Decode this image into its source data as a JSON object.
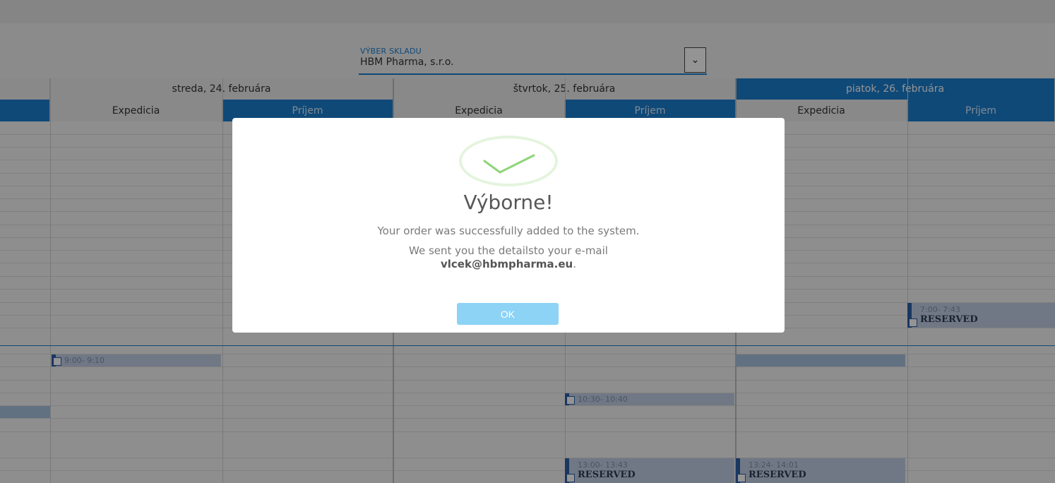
{
  "warehouse": {
    "label": "VÝBER SKLADU",
    "value": "HBM Pharma, s.r.o.",
    "dropdown_icon": "chevron-down-icon"
  },
  "days": [
    {
      "label": "streda, 24. februára",
      "active": false
    },
    {
      "label": "štvrtok, 25. februára",
      "active": false
    },
    {
      "label": "piatok, 26. februára",
      "active": true
    }
  ],
  "columns": {
    "expedicia": "Expedicia",
    "prijem": "Príjem"
  },
  "bookings": [
    {
      "time": "9:00- 9:10",
      "status": ""
    },
    {
      "time": "10:30- 10:40",
      "status": ""
    },
    {
      "time": "7:00- 7:43",
      "status": "RESERVED"
    },
    {
      "time": "13:00- 13:43",
      "status": "RESERVED"
    },
    {
      "time": "13:24- 14:01",
      "status": "RESERVED"
    }
  ],
  "modal": {
    "icon": "check-icon",
    "title": "Výborne!",
    "message": "Your order was successfully added to the system.",
    "details_prefix": "We sent you the detailsto your e-mail",
    "email": "vlcek@hbmpharma.eu",
    "email_suffix": ".",
    "ok_label": "OK"
  },
  "colors": {
    "accent": "#1a7fcf",
    "booking": "#c3cfe6",
    "ok_button": "#8cd3f6"
  }
}
